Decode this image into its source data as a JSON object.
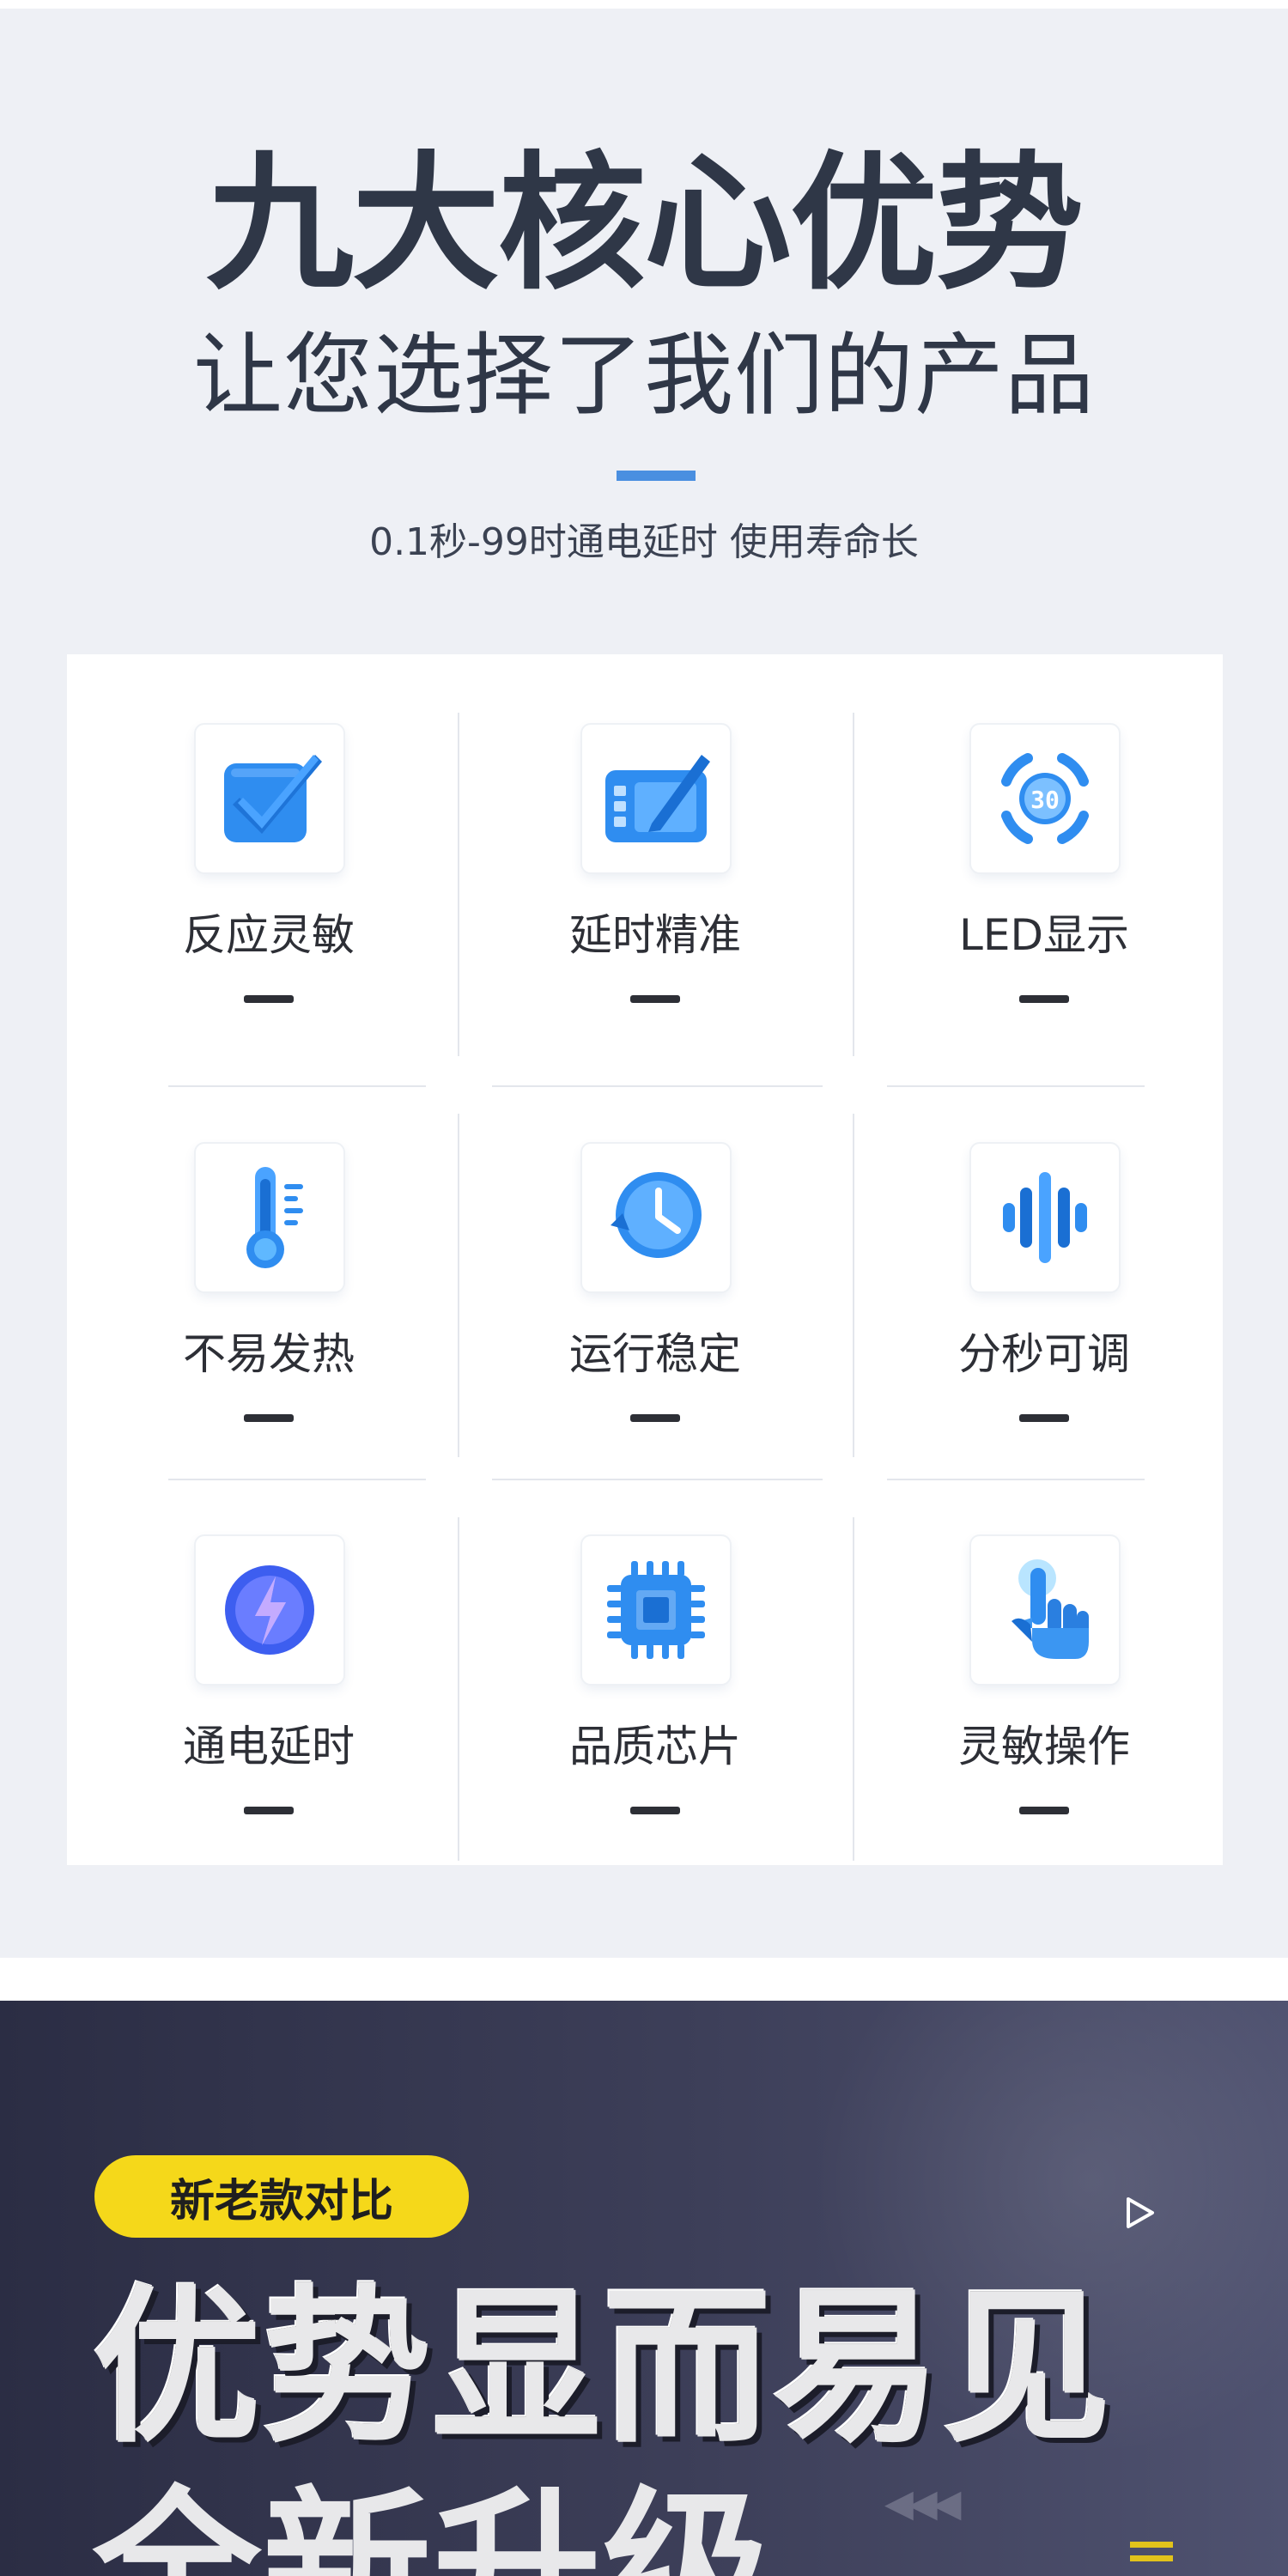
{
  "advantages": {
    "title": "九大核心优势",
    "subtitle": "让您选择了我们的产品",
    "tagline": "0.1秒-99时通电延时 使用寿命长",
    "accent_color": "#4a8fe0",
    "features": [
      {
        "label": "反应灵敏",
        "icon": "checkbox-icon"
      },
      {
        "label": "延时精准",
        "icon": "tablet-pen-icon"
      },
      {
        "label": "LED显示",
        "icon": "led-display-icon",
        "display_value": "30"
      },
      {
        "label": "不易发热",
        "icon": "thermometer-icon"
      },
      {
        "label": "运行稳定",
        "icon": "clock-icon"
      },
      {
        "label": "分秒可调",
        "icon": "sound-wave-icon"
      },
      {
        "label": "通电延时",
        "icon": "lightning-icon"
      },
      {
        "label": "品质芯片",
        "icon": "chip-icon"
      },
      {
        "label": "灵敏操作",
        "icon": "hand-pointer-icon"
      }
    ]
  },
  "comparison": {
    "badge": "新老款对比",
    "headline": "优势显而易见",
    "headline_2": "全新升级",
    "badge_color": "#f5d81a"
  }
}
